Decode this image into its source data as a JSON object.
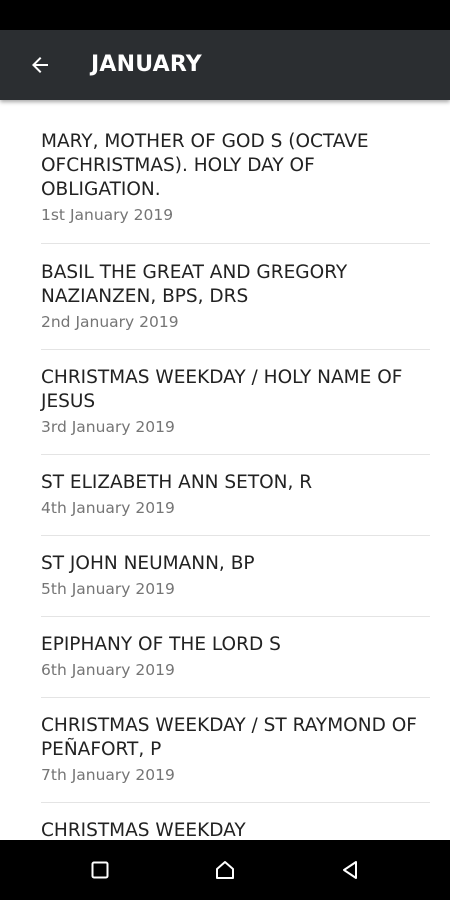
{
  "app_bar": {
    "title": "JANUARY",
    "back_icon": "arrow-left-icon"
  },
  "feasts": [
    {
      "title": "MARY, MOTHER OF GOD S (OCTAVE OFCHRISTMAS). HOLY DAY OF OBLIGATION.",
      "date": "1st January 2019"
    },
    {
      "title": "BASIL THE GREAT AND GREGORY NAZIANZEN, BPS, DRS",
      "date": "2nd January 2019"
    },
    {
      "title": "CHRISTMAS WEEKDAY / HOLY NAME OF JESUS",
      "date": "3rd January 2019"
    },
    {
      "title": "ST ELIZABETH ANN SETON, R",
      "date": "4th January 2019"
    },
    {
      "title": "ST JOHN NEUMANN, BP",
      "date": "5th January 2019"
    },
    {
      "title": "EPIPHANY OF THE LORD S",
      "date": "6th January 2019"
    },
    {
      "title": "CHRISTMAS WEEKDAY / ST RAYMOND OF PEÑAFORT, P",
      "date": "7th January 2019"
    },
    {
      "title": "CHRISTMAS WEEKDAY",
      "date": ""
    }
  ],
  "nav_bar": {
    "icons": [
      "recents-square-icon",
      "home-icon",
      "back-triangle-icon"
    ]
  },
  "colors": {
    "app_bar": "#2b2e31",
    "title_text": "#222222",
    "date_text": "#757575",
    "divider": "#e4e4e4"
  }
}
